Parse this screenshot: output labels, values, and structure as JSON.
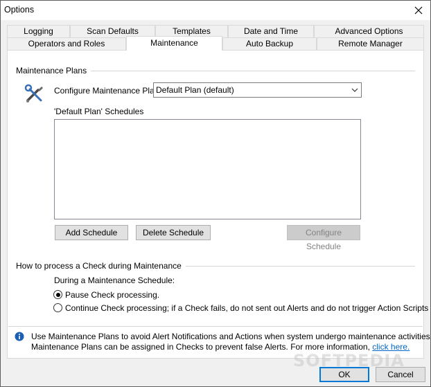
{
  "window": {
    "title": "Options"
  },
  "tabs_row1": [
    "Logging",
    "Scan Defaults",
    "Templates",
    "Date and Time",
    "Advanced Options"
  ],
  "tabs_row2": [
    "Operators and Roles",
    "Maintenance",
    "Auto Backup",
    "Remote Manager"
  ],
  "active_tab": "Maintenance",
  "maintenance_plans": {
    "group_label": "Maintenance Plans",
    "configure_label": "Configure Maintenance Plan:",
    "selected_plan": "Default Plan (default)",
    "schedules_label": "'Default Plan' Schedules",
    "schedules": [],
    "add_schedule": "Add Schedule",
    "delete_schedule": "Delete Schedule",
    "configure_schedule": "Configure Schedule"
  },
  "process_check": {
    "group_label": "How to process a Check during Maintenance",
    "during_label": "During a Maintenance Schedule:",
    "option_pause": "Pause Check processing.",
    "option_continue": "Continue Check processing; if a Check fails, do not sent out Alerts and do not trigger Action Scripts",
    "selected": "pause"
  },
  "info": {
    "line1": "Use Maintenance Plans to avoid Alert Notifications and Actions when system undergo maintenance activities.",
    "line2": "Maintenance Plans can be assigned in Checks to prevent false Alerts. For more information,",
    "link": "click here."
  },
  "footer": {
    "ok": "OK",
    "cancel": "Cancel"
  },
  "watermark": "SOFTPEDIA",
  "colors": {
    "accent": "#0078d7",
    "info_icon": "#1a5fb4",
    "link": "#0066cc"
  }
}
